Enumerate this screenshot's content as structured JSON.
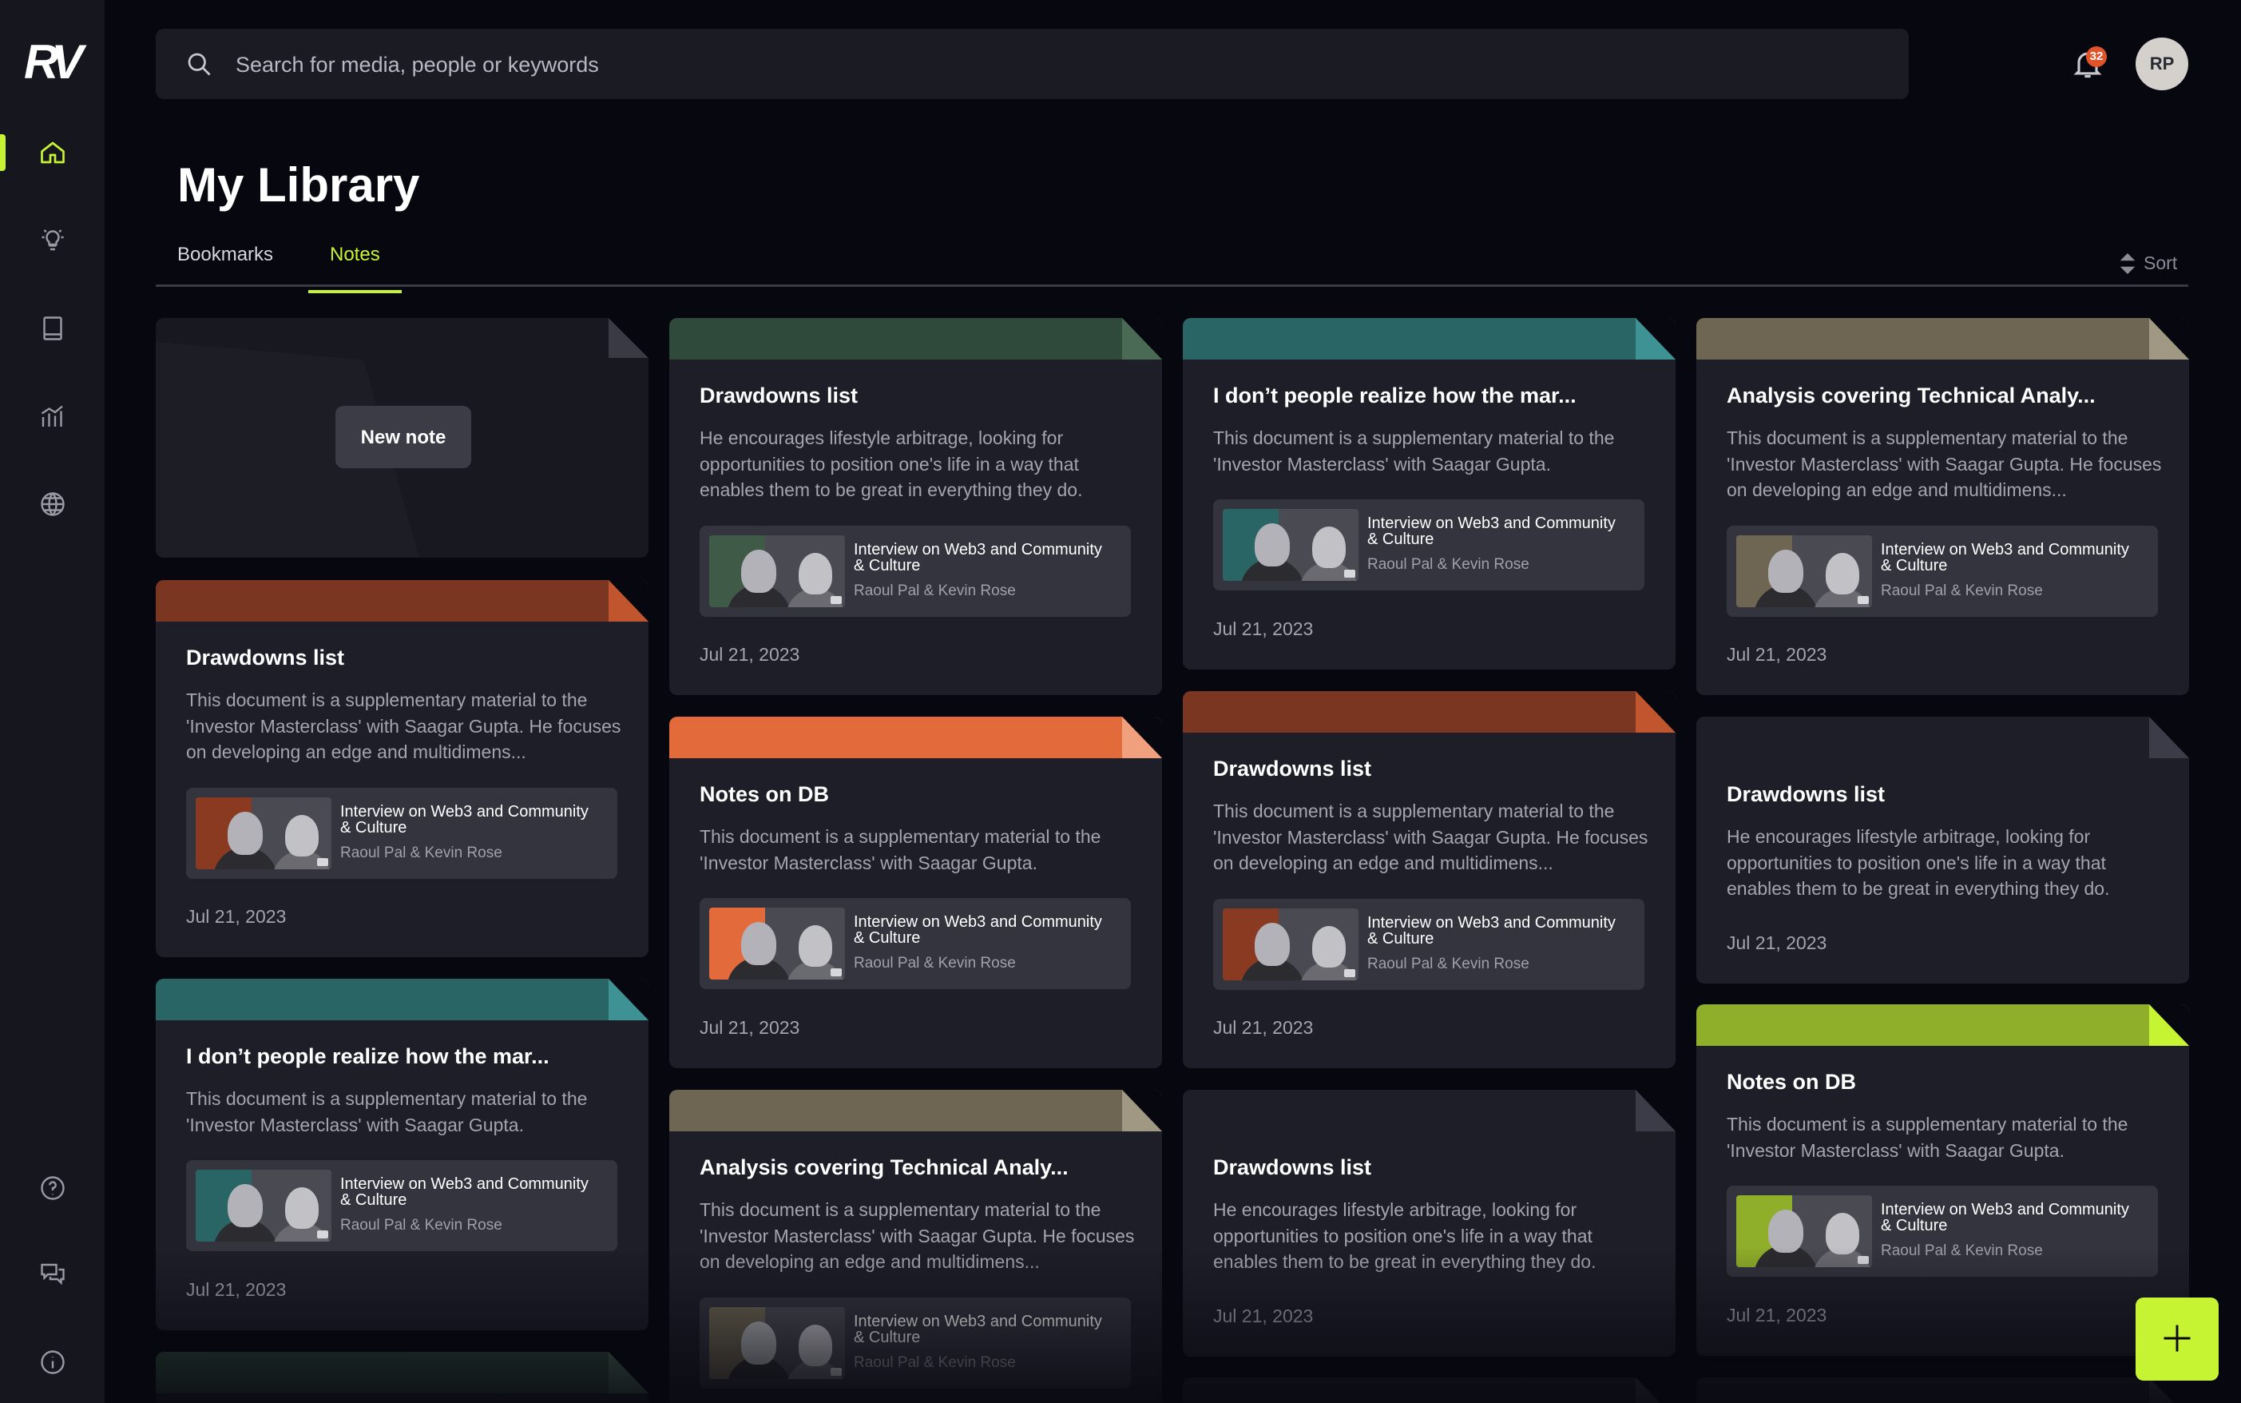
{
  "app": {
    "logo_text": "RV"
  },
  "header": {
    "search_placeholder": "Search for media, people or keywords",
    "notification_count": "32",
    "avatar_initials": "RP"
  },
  "page": {
    "title": "My Library",
    "tabs": [
      {
        "label": "Bookmarks",
        "active": false
      },
      {
        "label": "Notes",
        "active": true
      }
    ],
    "sort_label": "Sort"
  },
  "new_note": {
    "label": "New note"
  },
  "sidebar": {
    "items": [
      {
        "icon": "home-icon",
        "active": true
      },
      {
        "icon": "lightbulb-icon",
        "active": false
      },
      {
        "icon": "book-icon",
        "active": false
      },
      {
        "icon": "chart-icon",
        "active": false
      },
      {
        "icon": "globe-icon",
        "active": false
      },
      {
        "icon": "help-icon",
        "active": false
      },
      {
        "icon": "chat-icon",
        "active": false
      },
      {
        "icon": "info-icon",
        "active": false
      }
    ]
  },
  "colors": {
    "accent": "#c6f432",
    "green": "#2f4a3a",
    "teal": "#2a6566",
    "tan": "#6e6652",
    "orange_dark": "#7a3620",
    "orange_bright": "#e36a3a",
    "lime": "#8fae2a"
  },
  "cards": [
    {
      "title": "Drawdowns list",
      "text": "He encourages lifestyle arbitrage, looking for opportunities to position one's life in a way that enables them to be great in everything they do.",
      "clip_title": "Interview on Web3 and Community & Culture",
      "clip_sub": "Raoul Pal & Kevin Rose",
      "date": "Jul 21, 2023"
    },
    {
      "title": "I don’t people realize how the mar...",
      "text": "This document is a supplementary material to the 'Investor Masterclass' with Saagar Gupta.",
      "clip_title": "Interview on Web3 and Community & Culture",
      "clip_sub": "Raoul Pal & Kevin Rose",
      "date": "Jul 21, 2023"
    },
    {
      "title": "Analysis covering Technical Analy...",
      "text": "This document is a supplementary material to the 'Investor Masterclass' with Saagar Gupta. He focuses on developing an edge and multidimens...",
      "clip_title": "Interview on Web3 and Community & Culture",
      "clip_sub": "Raoul Pal & Kevin Rose",
      "date": "Jul 21, 2023"
    },
    {
      "title": "Drawdowns list",
      "text": "This document is a supplementary material to the 'Investor Masterclass' with Saagar Gupta. He focuses on developing an edge and multidimens...",
      "clip_title": "Interview on Web3 and Community & Culture",
      "clip_sub": "Raoul Pal & Kevin Rose",
      "date": "Jul 21, 2023"
    },
    {
      "title": "Notes on DB",
      "text": "This document is a supplementary material to the 'Investor Masterclass' with Saagar Gupta.",
      "clip_title": "Interview on Web3 and Community & Culture",
      "clip_sub": "Raoul Pal & Kevin Rose",
      "date": "Jul 21, 2023"
    },
    {
      "title": "Drawdowns list",
      "text": "This document is a supplementary material to the 'Investor Masterclass' with Saagar Gupta. He focuses on developing an edge and multidimens...",
      "clip_title": "Interview on Web3 and Community & Culture",
      "clip_sub": "Raoul Pal & Kevin Rose",
      "date": "Jul 21, 2023"
    },
    {
      "title": "Drawdowns list",
      "text": "He encourages lifestyle arbitrage, looking for opportunities to position one's life in a way that enables them to be great in everything they do.",
      "date": "Jul 21, 2023"
    },
    {
      "title": "I don’t people realize how the mar...",
      "text": "This document is a supplementary material to the 'Investor Masterclass' with Saagar Gupta.",
      "clip_title": "Interview on Web3 and Community & Culture",
      "clip_sub": "Raoul Pal & Kevin Rose",
      "date": "Jul 21, 2023"
    },
    {
      "title": "Analysis covering Technical Analy...",
      "text": "This document is a supplementary material to the 'Investor Masterclass' with Saagar Gupta. He focuses on developing an edge and multidimens...",
      "clip_title": "Interview on Web3 and Community & Culture",
      "clip_sub": "Raoul Pal & Kevin Rose"
    },
    {
      "title": "Drawdowns list",
      "text": "He encourages lifestyle arbitrage, looking for opportunities to position one's life in a way that enables them to be great in everything they do.",
      "date": "Jul 21, 2023"
    },
    {
      "title": "Notes on DB",
      "text": "This document is a supplementary material to the 'Investor Masterclass' with Saagar Gupta.",
      "clip_title": "Interview on Web3 and Community & Culture",
      "clip_sub": "Raoul Pal & Kevin Rose",
      "date": "Jul 21, 2023"
    }
  ]
}
